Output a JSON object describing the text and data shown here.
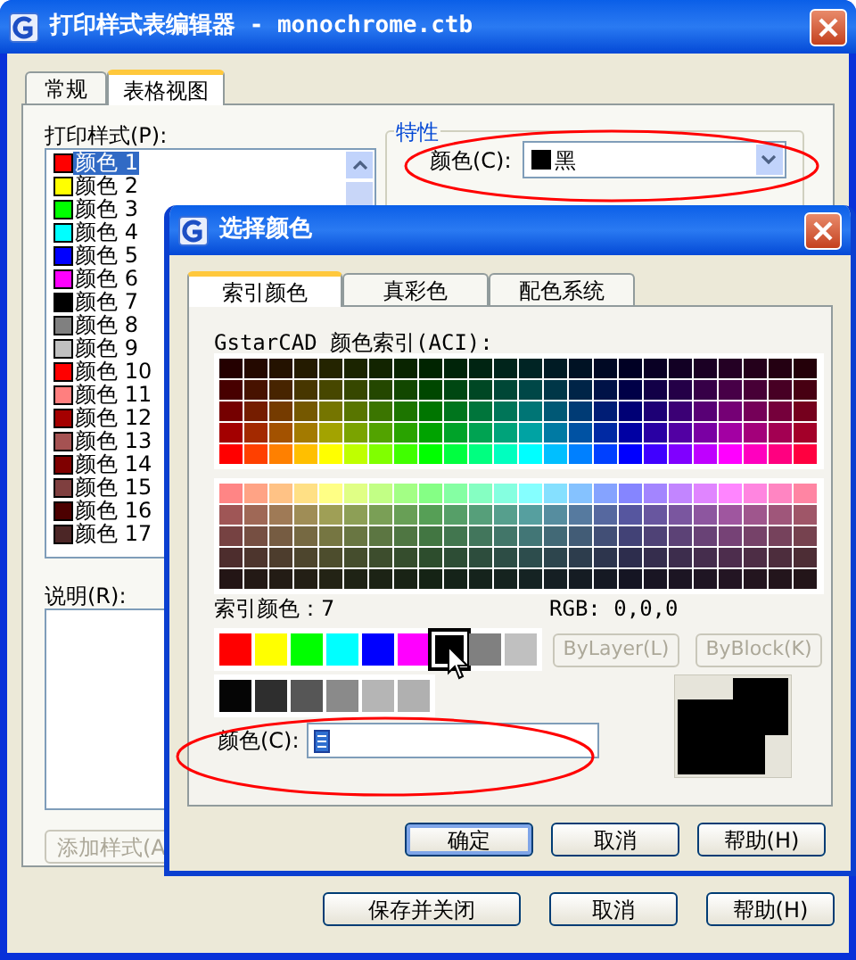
{
  "window": {
    "title": "打印样式表编辑器 - monochrome.ctb"
  },
  "tabs": [
    {
      "label": "常规",
      "selected": false
    },
    {
      "label": "表格视图",
      "selected": true
    }
  ],
  "print_styles": {
    "label": "打印样式(P):",
    "items": [
      {
        "name": "颜色 1",
        "color": "#ff0000",
        "selected": true
      },
      {
        "name": "颜色 2",
        "color": "#ffff00",
        "selected": false
      },
      {
        "name": "颜色 3",
        "color": "#00ff00",
        "selected": false
      },
      {
        "name": "颜色 4",
        "color": "#00ffff",
        "selected": false
      },
      {
        "name": "颜色 5",
        "color": "#0000ff",
        "selected": false
      },
      {
        "name": "颜色 6",
        "color": "#ff00ff",
        "selected": false
      },
      {
        "name": "颜色 7",
        "color": "#000000",
        "selected": false
      },
      {
        "name": "颜色 8",
        "color": "#808080",
        "selected": false
      },
      {
        "name": "颜色 9",
        "color": "#c0c0c0",
        "selected": false
      },
      {
        "name": "颜色 10",
        "color": "#ff0000",
        "selected": false
      },
      {
        "name": "颜色 11",
        "color": "#ff7f7f",
        "selected": false
      },
      {
        "name": "颜色 12",
        "color": "#a50000",
        "selected": false
      },
      {
        "name": "颜色 13",
        "color": "#a55252",
        "selected": false
      },
      {
        "name": "颜色 14",
        "color": "#7f0000",
        "selected": false
      },
      {
        "name": "颜色 15",
        "color": "#7f3f3f",
        "selected": false
      },
      {
        "name": "颜色 16",
        "color": "#4c0000",
        "selected": false
      },
      {
        "name": "颜色 17",
        "color": "#4c2626",
        "selected": false
      }
    ]
  },
  "description": {
    "label": "说明(R):"
  },
  "add_button": {
    "label": "添加样式(A",
    "disabled": true
  },
  "properties": {
    "title": "特性",
    "color_label": "颜色(C):",
    "color_value": "黑"
  },
  "buttons": [
    {
      "label": "保存并关闭"
    },
    {
      "label": "取消"
    },
    {
      "label": "帮助(H)"
    }
  ],
  "dialog": {
    "title": "选择颜色",
    "tabs": [
      {
        "label": "索引颜色",
        "selected": true
      },
      {
        "label": "真彩色",
        "selected": false
      },
      {
        "label": "配色系统",
        "selected": false
      }
    ],
    "palette_label": "GstarCAD 颜色索引(ACI):",
    "index_reading": "索引颜色：7",
    "rgb_reading": "RGB: 0,0,0",
    "standard_colors": [
      {
        "color": "#ff0000",
        "selected": false
      },
      {
        "color": "#ffff00",
        "selected": false
      },
      {
        "color": "#00ff00",
        "selected": false
      },
      {
        "color": "#00ffff",
        "selected": false
      },
      {
        "color": "#0000ff",
        "selected": false
      },
      {
        "color": "#ff00ff",
        "selected": false
      },
      {
        "color": "#000000",
        "selected": true
      },
      {
        "color": "#808080",
        "selected": false
      },
      {
        "color": "#c0c0c0",
        "selected": false
      }
    ],
    "gray_colors": [
      {
        "color": "#050505",
        "selected": false
      },
      {
        "color": "#2e2e2e",
        "selected": false
      },
      {
        "color": "#565656",
        "selected": false
      },
      {
        "color": "#8a8a8a",
        "selected": false
      },
      {
        "color": "#b5b5b5",
        "selected": false
      },
      {
        "color": "#b0b0b0",
        "selected": false
      }
    ],
    "layer_buttons": [
      {
        "label": "ByLayer(L)",
        "disabled": true
      },
      {
        "label": "ByBlock(K)",
        "disabled": true
      }
    ],
    "color_field": {
      "label": "颜色(C):"
    },
    "buttons": [
      {
        "label": "确定",
        "default": true
      },
      {
        "label": "取消",
        "default": false
      },
      {
        "label": "帮助(H)",
        "default": false
      }
    ]
  }
}
